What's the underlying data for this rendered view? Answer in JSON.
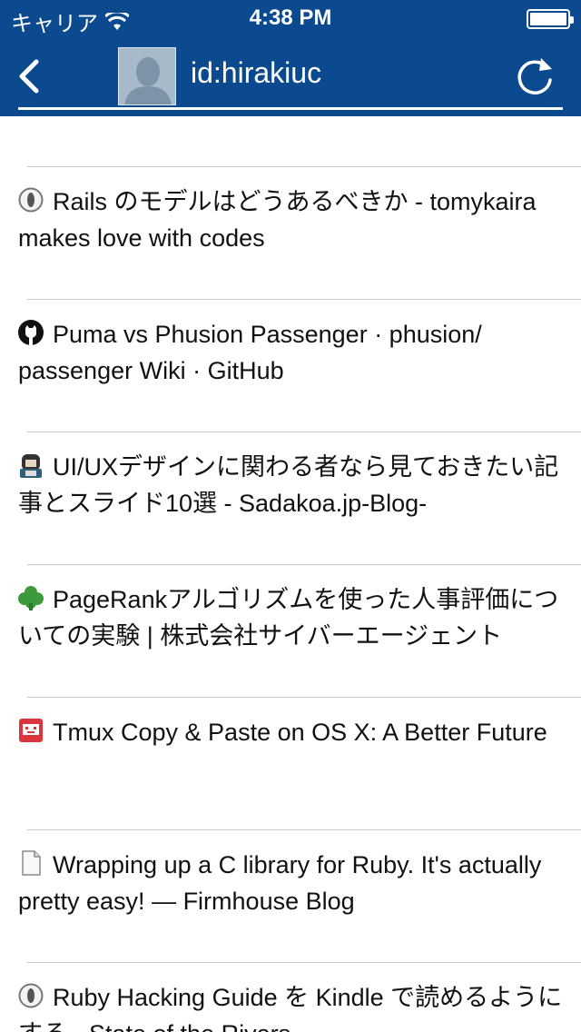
{
  "status_bar": {
    "carrier": "キャリア",
    "time": "4:38 PM"
  },
  "nav": {
    "title": "id:hirakiuc",
    "back_icon": "chevron-left-icon",
    "refresh_icon": "refresh-icon"
  },
  "colors": {
    "header_bg": "#0b4a8e",
    "separator": "#c8c8cc"
  },
  "bookmarks": [
    {
      "icon": "pin-icon",
      "title": "Rails のモデルはどうあるべきか - tomykaira makes love with codes"
    },
    {
      "icon": "github-icon",
      "title": "Puma vs Phusion Passenger · phusion/ passenger Wiki · GitHub"
    },
    {
      "icon": "sadakoa-icon",
      "title": "UI/UXデザインに関わる者なら見ておきたい記事とスライド10選 - Sadakoa.jp-Blog-"
    },
    {
      "icon": "green-leaf-icon",
      "title": "PageRankアルゴリズムを使った人事評価についての実験 | 株式会社サイバーエージェント"
    },
    {
      "icon": "red-robot-icon",
      "title": "Tmux Copy & Paste on OS X: A Better Future"
    },
    {
      "icon": "document-icon",
      "title": "Wrapping up a C library for Ruby. It's actually pretty easy! — Firmhouse Blog"
    },
    {
      "icon": "pin-icon",
      "title": "Ruby Hacking Guide を Kindle で読めるようにする - State of the Rivers"
    }
  ]
}
